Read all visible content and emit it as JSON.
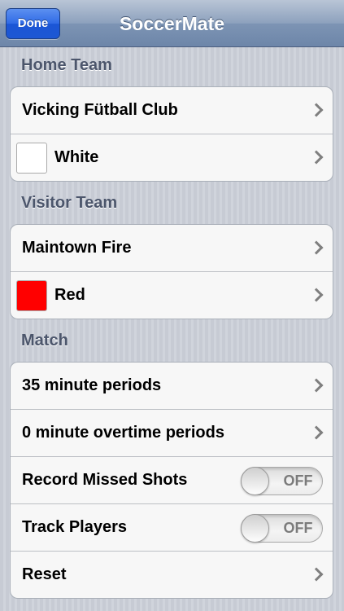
{
  "navbar": {
    "title": "SoccerMate",
    "done_label": "Done"
  },
  "home_team": {
    "header": "Home Team",
    "name": "Vicking Fütball Club",
    "color_name": "White",
    "color_hex": "#ffffff"
  },
  "visitor_team": {
    "header": "Visitor Team",
    "name": "Maintown Fire",
    "color_name": "Red",
    "color_hex": "#ff0000"
  },
  "match": {
    "header": "Match",
    "period_length": "35 minute periods",
    "overtime_length": "0 minute overtime periods",
    "record_missed_shots": {
      "label": "Record Missed Shots",
      "state": "OFF"
    },
    "track_players": {
      "label": "Track Players",
      "state": "OFF"
    },
    "reset_label": "Reset"
  },
  "icons": {
    "disclosure": "chevron-right-icon"
  }
}
